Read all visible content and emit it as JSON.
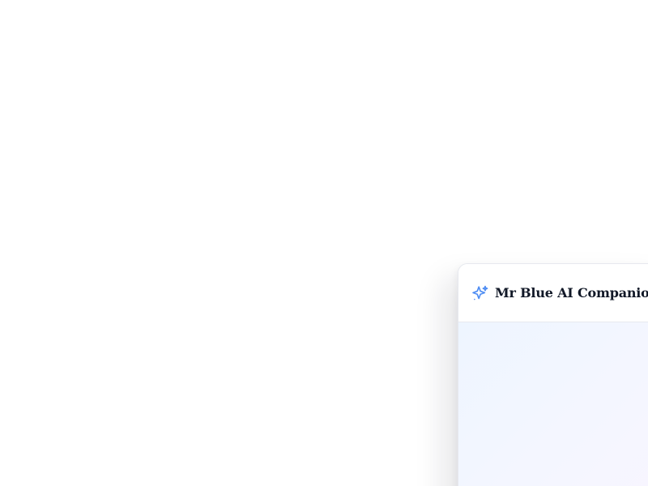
{
  "companion": {
    "title": "Mr Blue AI Companion",
    "icon": "sparkles-icon"
  },
  "colors": {
    "accent": "#4f8df3",
    "panel_bg": "#ffffff",
    "body_bg": "#eef5ff",
    "border": "#e6e8ee",
    "title": "#111827"
  }
}
